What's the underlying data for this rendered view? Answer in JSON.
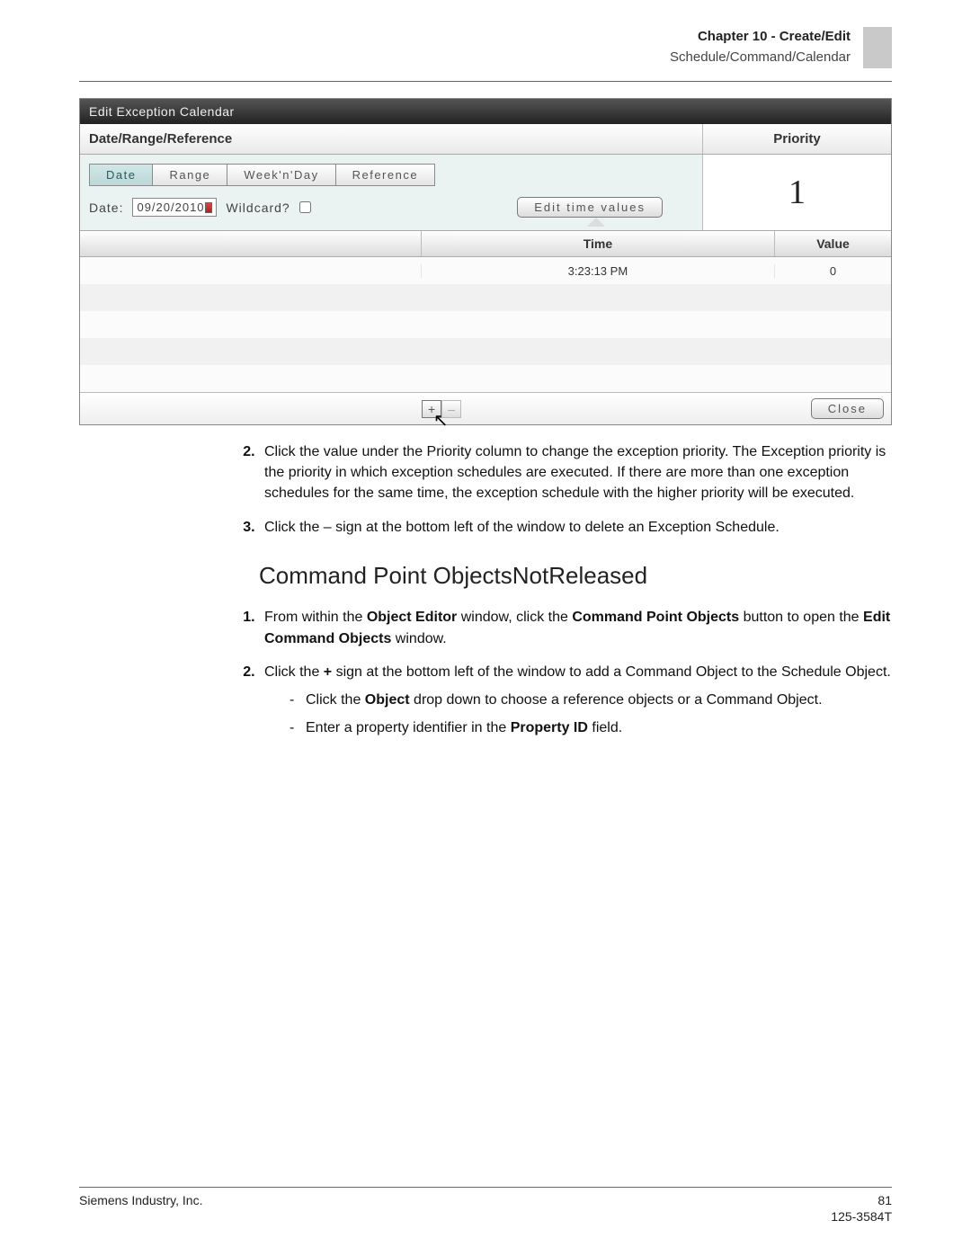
{
  "header": {
    "chapter": "Chapter 10 - Create/Edit",
    "subtitle": "Schedule/Command/Calendar"
  },
  "window": {
    "title": "Edit Exception Calendar",
    "section_left": "Date/Range/Reference",
    "section_right": "Priority",
    "tabs": {
      "date": "Date",
      "range": "Range",
      "weeknday": "Week'n'Day",
      "reference": "Reference"
    },
    "date_label": "Date:",
    "date_value": "09/20/2010",
    "wildcard_label": "Wildcard?",
    "edit_btn": "Edit time values",
    "priority_value": "1",
    "time_header": "Time",
    "value_header": "Value",
    "rows": [
      {
        "time": "3:23:13 PM",
        "value": "0"
      },
      {
        "time": "",
        "value": ""
      },
      {
        "time": "",
        "value": ""
      },
      {
        "time": "",
        "value": ""
      },
      {
        "time": "",
        "value": ""
      }
    ],
    "plus": "+",
    "minus": "–",
    "close": "Close"
  },
  "steps_a": {
    "s2": "Click the value under the Priority column to change the exception priority. The Exception priority is the priority in which exception schedules are executed. If there are more than one exception schedules for the same time, the exception schedule with the higher priority will be executed.",
    "s3": "Click the – sign at the bottom left of the window to delete an Exception Schedule."
  },
  "heading": "Command Point ObjectsNotReleased",
  "steps_b": {
    "s1_a": "From within the ",
    "s1_b": "Object Editor",
    "s1_c": " window, click the ",
    "s1_d": "Command Point Objects",
    "s1_e": " button to open the ",
    "s1_f": "Edit Command Objects",
    "s1_g": " window.",
    "s2_a": "Click the ",
    "s2_b": "+",
    "s2_c": " sign at the bottom left of the window to add a Command Object to the Schedule Object.",
    "d1_a": "Click the ",
    "d1_b": "Object",
    "d1_c": " drop down to choose a reference objects or a Command Object.",
    "d2_a": "Enter a property identifier in the ",
    "d2_b": "Property ID",
    "d2_c": " field."
  },
  "footer": {
    "company": "Siemens Industry, Inc.",
    "page": "81",
    "docnum": "125-3584T"
  }
}
